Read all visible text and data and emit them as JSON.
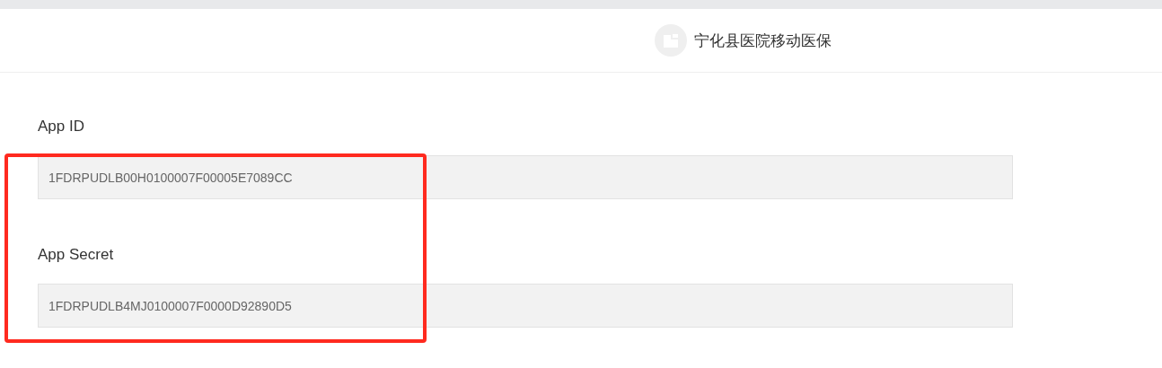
{
  "header": {
    "app_name": "宁化县医院移动医保"
  },
  "fields": [
    {
      "label": "App ID",
      "value": "1FDRPUDLB00H0100007F00005E7089CC"
    },
    {
      "label": "App Secret",
      "value": "1FDRPUDLB4MJ0100007F0000D92890D5"
    }
  ]
}
